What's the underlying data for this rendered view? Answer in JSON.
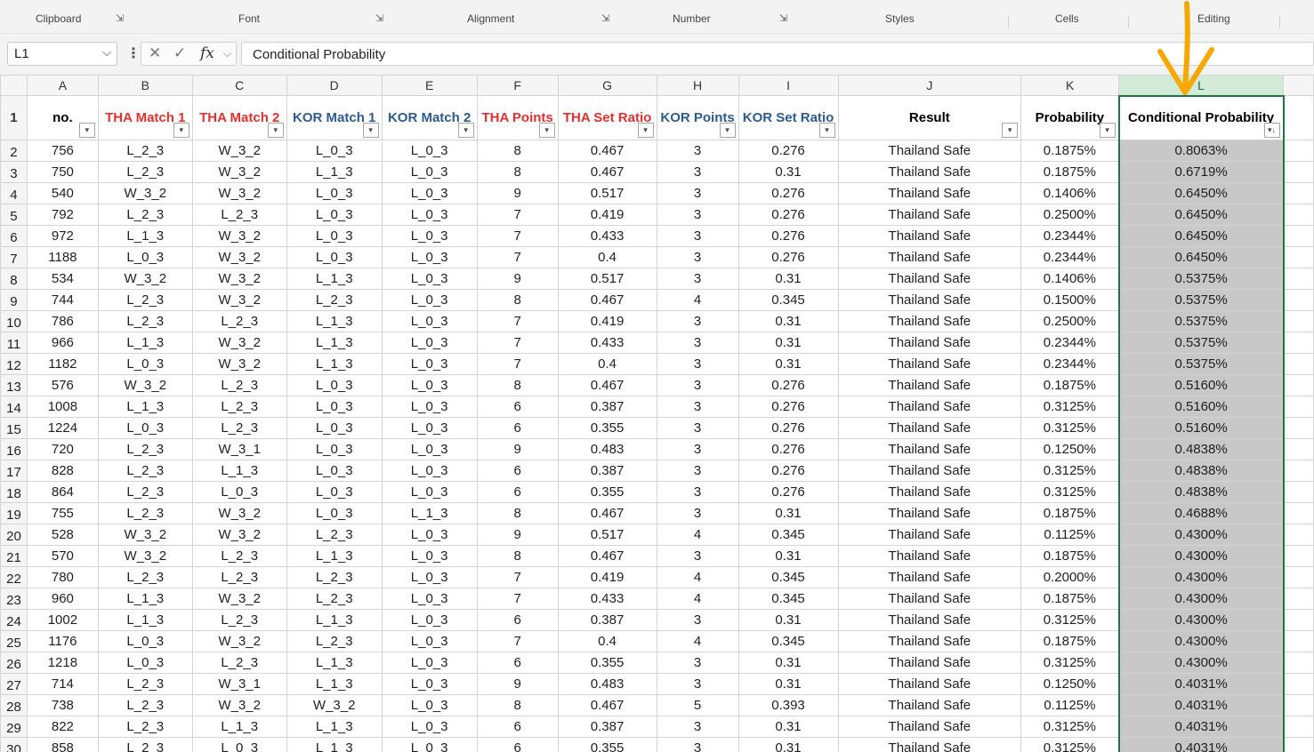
{
  "ribbon": {
    "groups": [
      "Clipboard",
      "Font",
      "Alignment",
      "Number",
      "Styles",
      "Cells",
      "Editing"
    ],
    "launcher_icon": "dialog-launcher-icon"
  },
  "formula_bar": {
    "name_box": "L1",
    "formula": "Conditional Probability",
    "fx_label": "fx"
  },
  "columns": [
    "A",
    "B",
    "C",
    "D",
    "E",
    "F",
    "G",
    "H",
    "I",
    "J",
    "K",
    "L"
  ],
  "selected_column": "L",
  "headers": [
    {
      "label": "no.",
      "color": "#000000"
    },
    {
      "label": "THA Match 1",
      "color": "#e03030"
    },
    {
      "label": "THA Match 2",
      "color": "#e03030"
    },
    {
      "label": "KOR Match 1",
      "color": "#2e5a8c"
    },
    {
      "label": "KOR Match 2",
      "color": "#2e5a8c"
    },
    {
      "label": "THA Points",
      "color": "#e03030"
    },
    {
      "label": "THA Set Ratio",
      "color": "#e03030"
    },
    {
      "label": "KOR Points",
      "color": "#2e5a8c"
    },
    {
      "label": "KOR Set Ratio",
      "color": "#2e5a8c"
    },
    {
      "label": "Result",
      "color": "#000000"
    },
    {
      "label": "Probability",
      "color": "#000000"
    },
    {
      "label": "Conditional Probability",
      "color": "#000000"
    }
  ],
  "rows": [
    [
      "2",
      "756",
      "L_2_3",
      "W_3_2",
      "L_0_3",
      "L_0_3",
      "8",
      "0.467",
      "3",
      "0.276",
      "Thailand Safe",
      "0.1875%",
      "0.8063%"
    ],
    [
      "3",
      "750",
      "L_2_3",
      "W_3_2",
      "L_1_3",
      "L_0_3",
      "8",
      "0.467",
      "3",
      "0.31",
      "Thailand Safe",
      "0.1875%",
      "0.6719%"
    ],
    [
      "4",
      "540",
      "W_3_2",
      "W_3_2",
      "L_0_3",
      "L_0_3",
      "9",
      "0.517",
      "3",
      "0.276",
      "Thailand Safe",
      "0.1406%",
      "0.6450%"
    ],
    [
      "5",
      "792",
      "L_2_3",
      "L_2_3",
      "L_0_3",
      "L_0_3",
      "7",
      "0.419",
      "3",
      "0.276",
      "Thailand Safe",
      "0.2500%",
      "0.6450%"
    ],
    [
      "6",
      "972",
      "L_1_3",
      "W_3_2",
      "L_0_3",
      "L_0_3",
      "7",
      "0.433",
      "3",
      "0.276",
      "Thailand Safe",
      "0.2344%",
      "0.6450%"
    ],
    [
      "7",
      "1188",
      "L_0_3",
      "W_3_2",
      "L_0_3",
      "L_0_3",
      "7",
      "0.4",
      "3",
      "0.276",
      "Thailand Safe",
      "0.2344%",
      "0.6450%"
    ],
    [
      "8",
      "534",
      "W_3_2",
      "W_3_2",
      "L_1_3",
      "L_0_3",
      "9",
      "0.517",
      "3",
      "0.31",
      "Thailand Safe",
      "0.1406%",
      "0.5375%"
    ],
    [
      "9",
      "744",
      "L_2_3",
      "W_3_2",
      "L_2_3",
      "L_0_3",
      "8",
      "0.467",
      "4",
      "0.345",
      "Thailand Safe",
      "0.1500%",
      "0.5375%"
    ],
    [
      "10",
      "786",
      "L_2_3",
      "L_2_3",
      "L_1_3",
      "L_0_3",
      "7",
      "0.419",
      "3",
      "0.31",
      "Thailand Safe",
      "0.2500%",
      "0.5375%"
    ],
    [
      "11",
      "966",
      "L_1_3",
      "W_3_2",
      "L_1_3",
      "L_0_3",
      "7",
      "0.433",
      "3",
      "0.31",
      "Thailand Safe",
      "0.2344%",
      "0.5375%"
    ],
    [
      "12",
      "1182",
      "L_0_3",
      "W_3_2",
      "L_1_3",
      "L_0_3",
      "7",
      "0.4",
      "3",
      "0.31",
      "Thailand Safe",
      "0.2344%",
      "0.5375%"
    ],
    [
      "13",
      "576",
      "W_3_2",
      "L_2_3",
      "L_0_3",
      "L_0_3",
      "8",
      "0.467",
      "3",
      "0.276",
      "Thailand Safe",
      "0.1875%",
      "0.5160%"
    ],
    [
      "14",
      "1008",
      "L_1_3",
      "L_2_3",
      "L_0_3",
      "L_0_3",
      "6",
      "0.387",
      "3",
      "0.276",
      "Thailand Safe",
      "0.3125%",
      "0.5160%"
    ],
    [
      "15",
      "1224",
      "L_0_3",
      "L_2_3",
      "L_0_3",
      "L_0_3",
      "6",
      "0.355",
      "3",
      "0.276",
      "Thailand Safe",
      "0.3125%",
      "0.5160%"
    ],
    [
      "16",
      "720",
      "L_2_3",
      "W_3_1",
      "L_0_3",
      "L_0_3",
      "9",
      "0.483",
      "3",
      "0.276",
      "Thailand Safe",
      "0.1250%",
      "0.4838%"
    ],
    [
      "17",
      "828",
      "L_2_3",
      "L_1_3",
      "L_0_3",
      "L_0_3",
      "6",
      "0.387",
      "3",
      "0.276",
      "Thailand Safe",
      "0.3125%",
      "0.4838%"
    ],
    [
      "18",
      "864",
      "L_2_3",
      "L_0_3",
      "L_0_3",
      "L_0_3",
      "6",
      "0.355",
      "3",
      "0.276",
      "Thailand Safe",
      "0.3125%",
      "0.4838%"
    ],
    [
      "19",
      "755",
      "L_2_3",
      "W_3_2",
      "L_0_3",
      "L_1_3",
      "8",
      "0.467",
      "3",
      "0.31",
      "Thailand Safe",
      "0.1875%",
      "0.4688%"
    ],
    [
      "20",
      "528",
      "W_3_2",
      "W_3_2",
      "L_2_3",
      "L_0_3",
      "9",
      "0.517",
      "4",
      "0.345",
      "Thailand Safe",
      "0.1125%",
      "0.4300%"
    ],
    [
      "21",
      "570",
      "W_3_2",
      "L_2_3",
      "L_1_3",
      "L_0_3",
      "8",
      "0.467",
      "3",
      "0.31",
      "Thailand Safe",
      "0.1875%",
      "0.4300%"
    ],
    [
      "22",
      "780",
      "L_2_3",
      "L_2_3",
      "L_2_3",
      "L_0_3",
      "7",
      "0.419",
      "4",
      "0.345",
      "Thailand Safe",
      "0.2000%",
      "0.4300%"
    ],
    [
      "23",
      "960",
      "L_1_3",
      "W_3_2",
      "L_2_3",
      "L_0_3",
      "7",
      "0.433",
      "4",
      "0.345",
      "Thailand Safe",
      "0.1875%",
      "0.4300%"
    ],
    [
      "24",
      "1002",
      "L_1_3",
      "L_2_3",
      "L_1_3",
      "L_0_3",
      "6",
      "0.387",
      "3",
      "0.31",
      "Thailand Safe",
      "0.3125%",
      "0.4300%"
    ],
    [
      "25",
      "1176",
      "L_0_3",
      "W_3_2",
      "L_2_3",
      "L_0_3",
      "7",
      "0.4",
      "4",
      "0.345",
      "Thailand Safe",
      "0.1875%",
      "0.4300%"
    ],
    [
      "26",
      "1218",
      "L_0_3",
      "L_2_3",
      "L_1_3",
      "L_0_3",
      "6",
      "0.355",
      "3",
      "0.31",
      "Thailand Safe",
      "0.3125%",
      "0.4300%"
    ],
    [
      "27",
      "714",
      "L_2_3",
      "W_3_1",
      "L_1_3",
      "L_0_3",
      "9",
      "0.483",
      "3",
      "0.31",
      "Thailand Safe",
      "0.1250%",
      "0.4031%"
    ],
    [
      "28",
      "738",
      "L_2_3",
      "W_3_2",
      "W_3_2",
      "L_0_3",
      "8",
      "0.467",
      "5",
      "0.393",
      "Thailand Safe",
      "0.1125%",
      "0.4031%"
    ],
    [
      "29",
      "822",
      "L_2_3",
      "L_1_3",
      "L_1_3",
      "L_0_3",
      "6",
      "0.387",
      "3",
      "0.31",
      "Thailand Safe",
      "0.3125%",
      "0.4031%"
    ],
    [
      "30",
      "858",
      "L_2_3",
      "L_0_3",
      "L_1_3",
      "L_0_3",
      "6",
      "0.355",
      "3",
      "0.31",
      "Thailand Safe",
      "0.3125%",
      "0.4031%"
    ]
  ],
  "annotation": {
    "arrow_color": "#f5a800",
    "arrow_icon": "down-arrow-annotation-icon"
  }
}
